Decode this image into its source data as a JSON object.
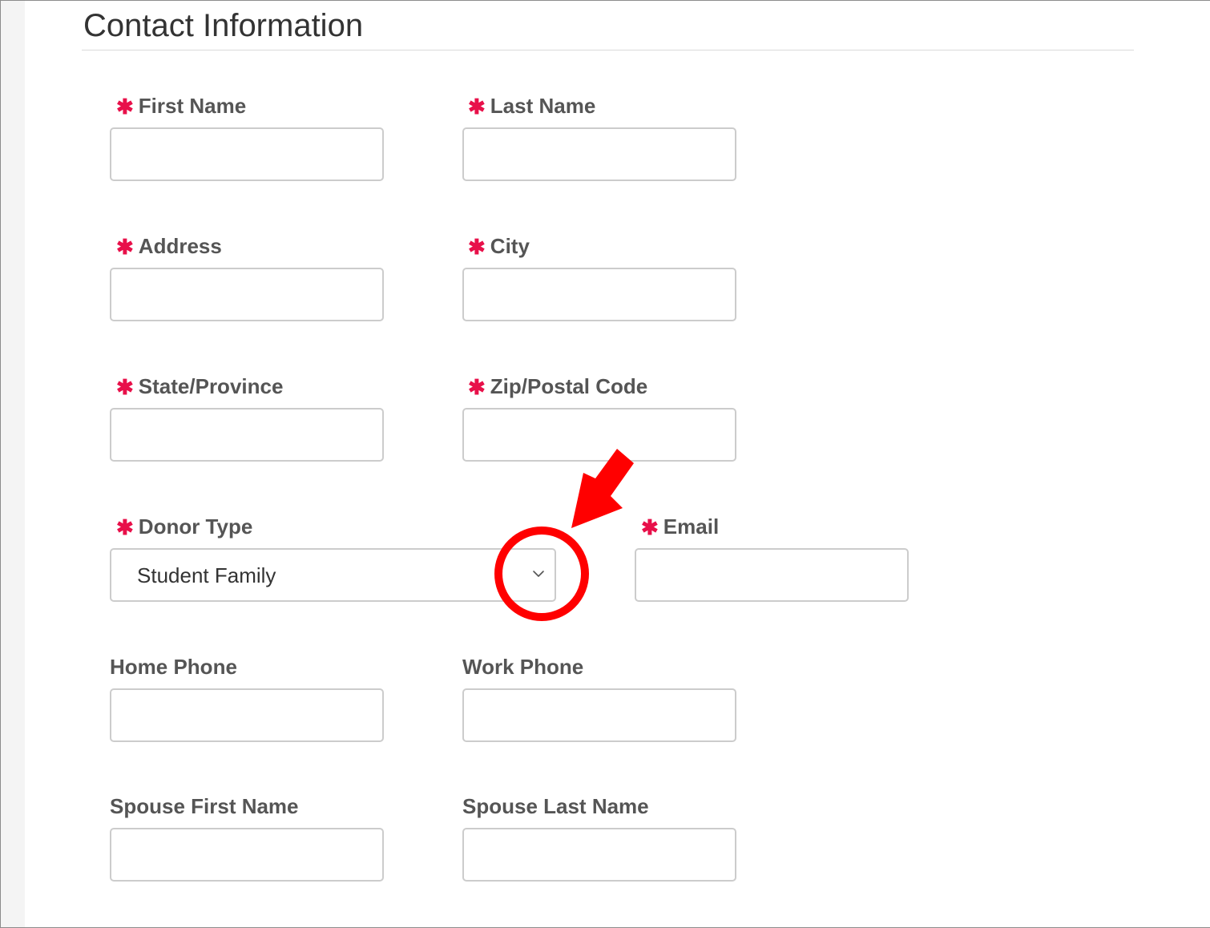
{
  "section": {
    "title": "Contact Information"
  },
  "required_marker": "✱",
  "fields": {
    "first_name": {
      "label": "First Name",
      "value": ""
    },
    "last_name": {
      "label": "Last Name",
      "value": ""
    },
    "address": {
      "label": "Address",
      "value": ""
    },
    "city": {
      "label": "City",
      "value": ""
    },
    "state": {
      "label": "State/Province",
      "value": ""
    },
    "zip": {
      "label": "Zip/Postal Code",
      "value": ""
    },
    "donor_type": {
      "label": "Donor Type",
      "selected": "Student Family"
    },
    "email": {
      "label": "Email",
      "value": ""
    },
    "home_phone": {
      "label": "Home Phone",
      "value": ""
    },
    "work_phone": {
      "label": "Work Phone",
      "value": ""
    },
    "spouse_first": {
      "label": "Spouse First Name",
      "value": ""
    },
    "spouse_last": {
      "label": "Spouse Last Name",
      "value": ""
    }
  },
  "colors": {
    "required": "#e8104a",
    "annotation": "#ff0000",
    "label": "#555555"
  },
  "icons": {
    "dropdown": "chevron-down-icon",
    "annotation_arrow": "arrow-icon",
    "annotation_circle": "highlight-circle"
  }
}
